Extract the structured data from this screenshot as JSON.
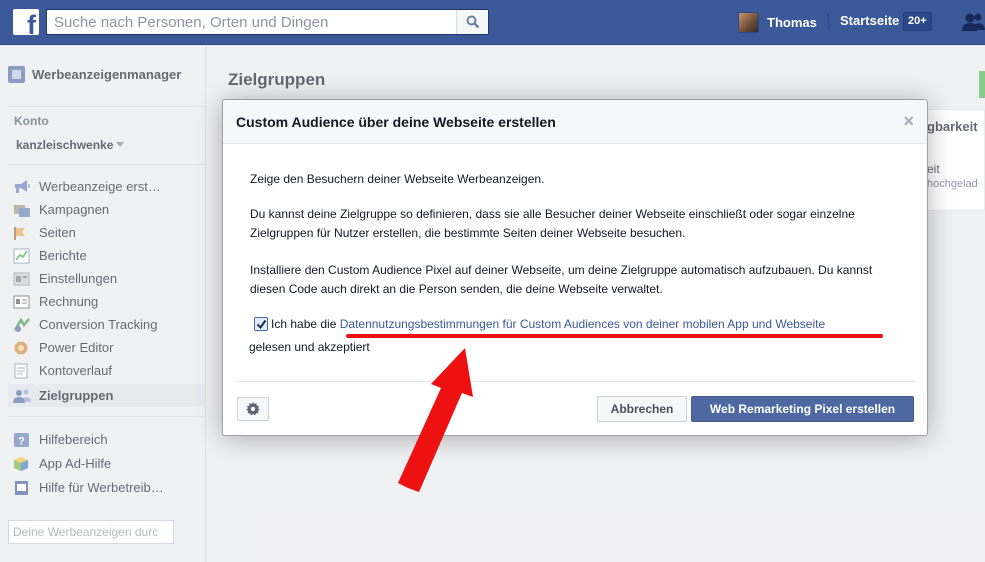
{
  "topbar": {
    "logo": "f",
    "search_placeholder": "Suche nach Personen, Orten und Dingen",
    "user_name": "Thomas",
    "home_label": "Startseite",
    "home_badge": "20+"
  },
  "sidebar": {
    "title": "Werbeanzeigenmanager",
    "konto_label": "Konto",
    "account_name": "kanzleischwenke",
    "items": [
      {
        "label": "Werbeanzeige erst…",
        "icon": "megaphone-icon"
      },
      {
        "label": "Kampagnen",
        "icon": "campaign-icon"
      },
      {
        "label": "Seiten",
        "icon": "pages-icon"
      },
      {
        "label": "Berichte",
        "icon": "reports-icon"
      },
      {
        "label": "Einstellungen",
        "icon": "settings-icon"
      },
      {
        "label": "Rechnung",
        "icon": "billing-icon"
      },
      {
        "label": "Conversion Tracking",
        "icon": "conversion-icon"
      },
      {
        "label": "Power Editor",
        "icon": "power-editor-icon"
      },
      {
        "label": "Kontoverlauf",
        "icon": "history-icon"
      },
      {
        "label": "Zielgruppen",
        "icon": "audiences-icon"
      }
    ],
    "help_items": [
      {
        "label": "Hilfebereich",
        "icon": "help-icon"
      },
      {
        "label": "App Ad-Hilfe",
        "icon": "app-help-icon"
      },
      {
        "label": "Hilfe für Werbetreib…",
        "icon": "advertiser-help-icon"
      }
    ],
    "search_placeholder": "Deine Werbeanzeigen durc"
  },
  "main": {
    "title": "Zielgruppen",
    "panel_header": "gbarkeit",
    "panel_line1": "eit",
    "panel_line2": "hochgelad"
  },
  "dialog": {
    "title": "Custom Audience über deine Webseite erstellen",
    "close_label": "×",
    "paragraph1": "Zeige den Besuchern deiner Webseite Werbeanzeigen.",
    "paragraph2": "Du kannst deine Zielgruppe so definieren, dass sie alle Besucher deiner Webseite einschließt oder sogar einzelne Zielgruppen für Nutzer erstellen, die bestimmte Seiten deiner Webseite besuchen.",
    "paragraph3": "Installiere den Custom Audience Pixel auf deiner Webseite, um deine Zielgruppe automatisch aufzubauen. Du kannst diesen Code auch direkt an die Person senden, die deine Webseite verwaltet.",
    "checkbox_prefix": "Ich habe die",
    "checkbox_link": "Datennutzungsbestimmungen für Custom Audiences von deiner mobilen App und Webseite",
    "checkbox_suffix": "gelesen und akzeptiert",
    "checkbox_checked": true,
    "cancel_label": "Abbrechen",
    "primary_label": "Web Remarketing Pixel erstellen"
  },
  "colors": {
    "brand": "#3b5998",
    "primary_button": "#4e69a2",
    "annotation_red": "#ee1111"
  }
}
